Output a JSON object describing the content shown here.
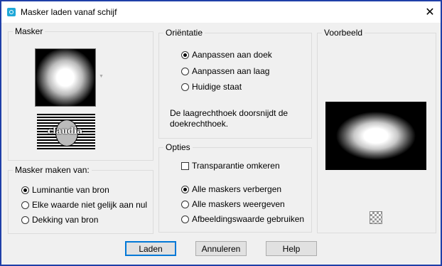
{
  "window": {
    "title": "Masker laden vanaf schijf"
  },
  "masker": {
    "label": "Masker",
    "logo_text": "claudia"
  },
  "maker": {
    "label": "Masker maken van:",
    "options": [
      {
        "label": "Luminantie van bron",
        "selected": true
      },
      {
        "label": "Elke waarde niet gelijk aan nul",
        "selected": false
      },
      {
        "label": "Dekking van bron",
        "selected": false
      }
    ]
  },
  "orientatie": {
    "label": "Oriëntatie",
    "options": [
      {
        "label": "Aanpassen aan doek",
        "selected": true
      },
      {
        "label": "Aanpassen aan laag",
        "selected": false
      },
      {
        "label": "Huidige staat",
        "selected": false
      }
    ],
    "info": "De laagrechthoek doorsnijdt de doekrechthoek."
  },
  "opties": {
    "label": "Opties",
    "invert": {
      "label": "Transparantie omkeren",
      "checked": false
    },
    "options": [
      {
        "label": "Alle maskers verbergen",
        "selected": true
      },
      {
        "label": "Alle maskers weergeven",
        "selected": false
      },
      {
        "label": "Afbeeldingswaarde gebruiken",
        "selected": false
      }
    ]
  },
  "voorbeeld": {
    "label": "Voorbeeld"
  },
  "buttons": {
    "load": "Laden",
    "cancel": "Annuleren",
    "help": "Help"
  },
  "colors": {
    "frame_border": "#1f3fa8",
    "default_button_border": "#0078d7",
    "app_icon": "#1fa8d8"
  },
  "icons": {
    "app": "paint-app-icon",
    "close": "close-icon",
    "transparency": "checkerboard-icon"
  }
}
